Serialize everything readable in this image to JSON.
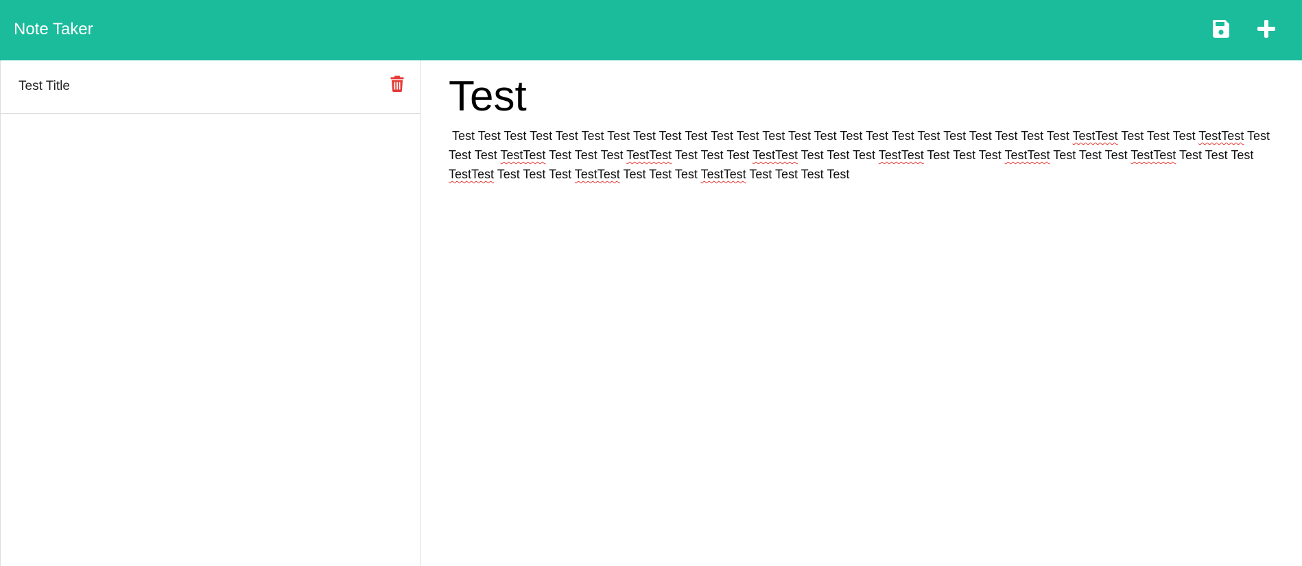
{
  "app": {
    "brand": "Note Taker"
  },
  "toolbar": {
    "save_icon": "floppy-disk-icon",
    "new_icon": "plus-icon"
  },
  "colors": {
    "navbar": "#1abc9c",
    "delete": "#e53935",
    "spellcheck_underline": "#e53935"
  },
  "sidebar": {
    "notes": [
      {
        "title": "Test Title",
        "delete_icon": "trash-icon"
      }
    ]
  },
  "editor": {
    "title": "Test",
    "body_segments": [
      {
        "text": " Test Test Test Test Test Test Test Test Test Test Test Test Test Test Test Test Test Test Test Test Test Test Test Test ",
        "misspelled": false
      },
      {
        "text": "TestTest",
        "misspelled": true
      },
      {
        "text": " Test Test Test ",
        "misspelled": false
      },
      {
        "text": "TestTest",
        "misspelled": true
      },
      {
        "text": " Test Test Test ",
        "misspelled": false
      },
      {
        "text": "TestTest",
        "misspelled": true
      },
      {
        "text": " Test Test Test ",
        "misspelled": false
      },
      {
        "text": "TestTest",
        "misspelled": true
      },
      {
        "text": " Test Test Test ",
        "misspelled": false
      },
      {
        "text": "TestTest",
        "misspelled": true
      },
      {
        "text": " Test Test Test ",
        "misspelled": false
      },
      {
        "text": "TestTest",
        "misspelled": true
      },
      {
        "text": " Test Test Test ",
        "misspelled": false
      },
      {
        "text": "TestTest",
        "misspelled": true
      },
      {
        "text": " Test Test Test ",
        "misspelled": false
      },
      {
        "text": "TestTest",
        "misspelled": true
      },
      {
        "text": " Test Test Test ",
        "misspelled": false
      },
      {
        "text": "TestTest",
        "misspelled": true
      },
      {
        "text": " Test Test Test ",
        "misspelled": false
      },
      {
        "text": "TestTest",
        "misspelled": true
      },
      {
        "text": " Test Test Test ",
        "misspelled": false
      },
      {
        "text": "TestTest",
        "misspelled": true
      },
      {
        "text": " Test Test Test Test",
        "misspelled": false
      }
    ]
  }
}
